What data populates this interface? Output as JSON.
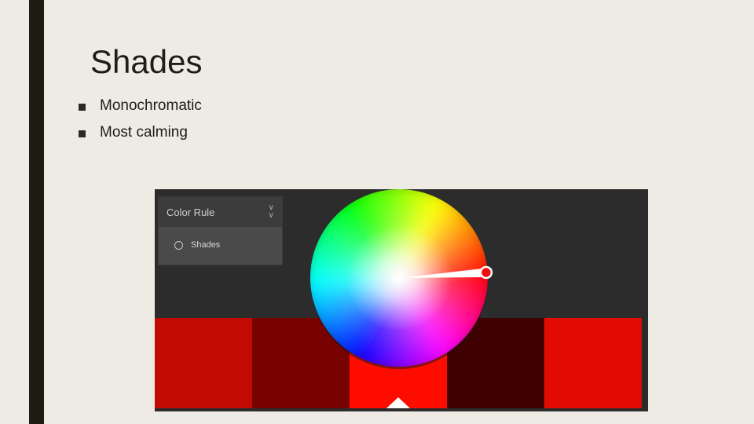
{
  "slide": {
    "title": "Shades",
    "bullets": [
      "Monochromatic",
      "Most calming"
    ]
  },
  "color_tool": {
    "panel": {
      "title": "Color Rule",
      "option": "Shades"
    },
    "swatches": [
      "#c20a02",
      "#770200",
      "#ff0c00",
      "#3e0000",
      "#e20c04"
    ],
    "selected_swatch": 2
  },
  "colors": {
    "background": "#eeebe4",
    "accent_bar": "#1c1c12",
    "tool_background": "#2c2c2c"
  }
}
